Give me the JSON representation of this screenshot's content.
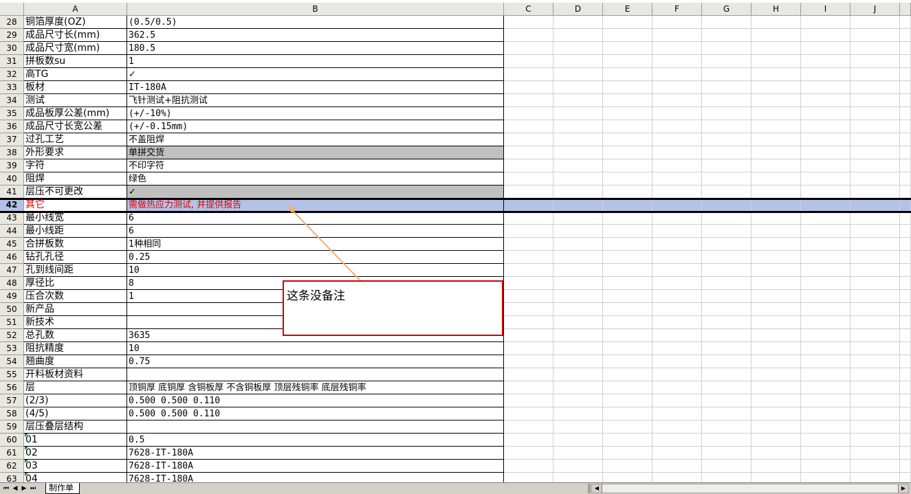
{
  "sheet": {
    "columns": [
      "A",
      "B",
      "C",
      "D",
      "E",
      "F",
      "G",
      "H",
      "I",
      "J"
    ],
    "rows": [
      {
        "n": "28",
        "a": "铜箔厚度(OZ)",
        "b": "(0.5/0.5)"
      },
      {
        "n": "29",
        "a": "成品尺寸长(mm)",
        "b": "362.5"
      },
      {
        "n": "30",
        "a": "成品尺寸宽(mm)",
        "b": "180.5"
      },
      {
        "n": "31",
        "a": "拼板数su",
        "b": "1"
      },
      {
        "n": "32",
        "a": "高TG",
        "b": "✓"
      },
      {
        "n": "33",
        "a": "板材",
        "b": "IT-180A"
      },
      {
        "n": "34",
        "a": "测试",
        "b": "飞针测试+阻抗测试"
      },
      {
        "n": "35",
        "a": "成品板厚公差(mm)",
        "b": "(+/-10%)"
      },
      {
        "n": "36",
        "a": "成品尺寸长宽公差",
        "b": "(+/-0.15mm)"
      },
      {
        "n": "37",
        "a": "过孔工艺",
        "b": "不盖阻焊"
      },
      {
        "n": "38",
        "a": "外形要求",
        "b": "单拼交货"
      },
      {
        "n": "39",
        "a": "字符",
        "b": "不印字符"
      },
      {
        "n": "40",
        "a": "阻焊",
        "b": "绿色"
      },
      {
        "n": "41",
        "a": "层压不可更改",
        "b": "✓"
      },
      {
        "n": "42",
        "a": "其它",
        "b": "需做热应力测试, 并提供报告"
      },
      {
        "n": "43",
        "a": "最小线宽",
        "b": "6"
      },
      {
        "n": "44",
        "a": "最小线距",
        "b": "6"
      },
      {
        "n": "45",
        "a": "合拼板数",
        "b": "1种相同"
      },
      {
        "n": "46",
        "a": "钻孔孔径",
        "b": "0.25"
      },
      {
        "n": "47",
        "a": "孔到线间距",
        "b": "10"
      },
      {
        "n": "48",
        "a": "厚径比",
        "b": "8"
      },
      {
        "n": "49",
        "a": "压合次数",
        "b": "1"
      },
      {
        "n": "50",
        "a": "新产品",
        "b": ""
      },
      {
        "n": "51",
        "a": "新技术",
        "b": ""
      },
      {
        "n": "52",
        "a": "总孔数",
        "b": "3635"
      },
      {
        "n": "53",
        "a": "阻抗精度",
        "b": "10"
      },
      {
        "n": "54",
        "a": "翘曲度",
        "b": "0.75"
      },
      {
        "n": "55",
        "a": "开料板材资料",
        "b": ""
      },
      {
        "n": "56",
        "a": "层",
        "b": "顶铜厚 底铜厚 含铜板厚 不含铜板厚 顶层残铜率 底层残铜率"
      },
      {
        "n": "57",
        "a": "(2/3)",
        "b": "0.500  0.500          0.110"
      },
      {
        "n": "58",
        "a": "(4/5)",
        "b": "0.500  0.500          0.110"
      },
      {
        "n": "59",
        "a": "层压叠层结构",
        "b": ""
      },
      {
        "n": "60",
        "a": "01",
        "b": "0.5"
      },
      {
        "n": "61",
        "a": "02",
        "b": "7628-IT-180A"
      },
      {
        "n": "62",
        "a": "03",
        "b": "7628-IT-180A"
      },
      {
        "n": "63",
        "a": "04",
        "b": "7628-IT-180A"
      }
    ]
  },
  "comment": {
    "text": "这条没备注"
  },
  "tabbar": {
    "sheet_tab": "制作单"
  },
  "colors": {
    "header_bg": "#e8e8e0",
    "selection": "#b3c2e6",
    "gray_fill": "#c0c0c0",
    "red_text": "#e00000",
    "comment_border": "#d40000",
    "arrow": "#f5b070"
  }
}
